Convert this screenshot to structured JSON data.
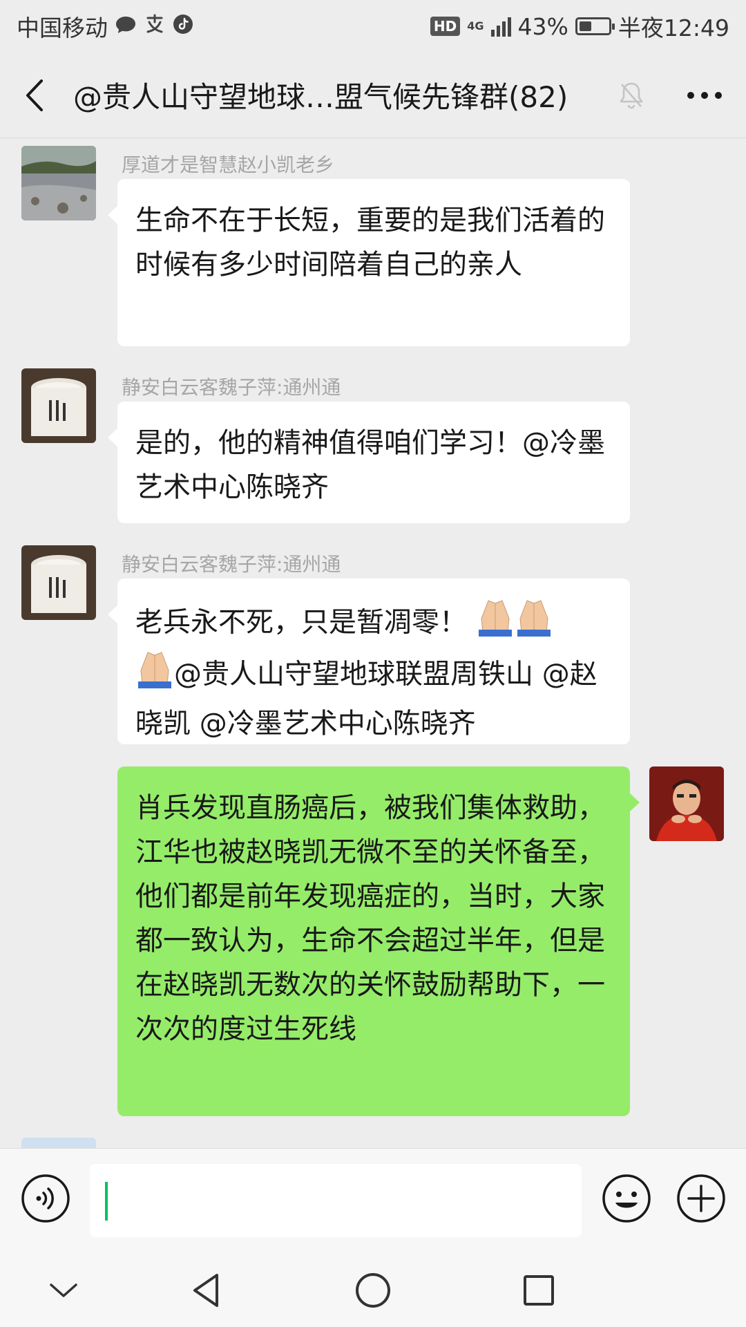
{
  "status_bar": {
    "carrier": "中国移动",
    "network": "4G",
    "battery": "43%",
    "battery_level": 0.43,
    "time": "半夜12:49"
  },
  "header": {
    "title": "@贵人山守望地球…盟气候先锋群(82)"
  },
  "messages": [
    {
      "sender": "厚道才是智慧赵小凯老乡",
      "text": "生命不在于长短，重要的是我们活着的时候有多少时间陪着自己的亲人",
      "direction": "incoming",
      "avatar": "river-landscape"
    },
    {
      "sender": "静安白云客魏子萍:通州通",
      "text": "是的，他的精神值得咱们学习！@冷墨艺术中心陈晓齐",
      "direction": "incoming",
      "avatar": "enamel-mug"
    },
    {
      "sender": "静安白云客魏子萍:通州通",
      "text_before": "老兵永不死，只是暂凋零！",
      "text_after": "@贵人山守望地球联盟周铁山 @赵晓凯  @冷墨艺术中心陈晓齐",
      "emoji_count": 3,
      "emoji": "folded-hands",
      "direction": "incoming",
      "avatar": "enamel-mug"
    },
    {
      "text": "肖兵发现直肠癌后，被我们集体救助，江华也被赵晓凯无微不至的关怀备至，他们都是前年发现癌症的，当时，大家都一致认为，生命不会超过半年，但是在赵晓凯无数次的关怀鼓励帮助下，一次次的度过生死线",
      "direction": "outgoing",
      "avatar": "man-in-red"
    }
  ],
  "input": {
    "value": "",
    "placeholder": ""
  },
  "icons": {
    "back": "back-arrow-icon",
    "mute": "bell-muted-icon",
    "more": "more-dots-icon",
    "voice": "voice-icon",
    "emoji": "emoji-smile-icon",
    "plus": "plus-icon",
    "nav_down": "chevron-down-icon",
    "nav_back": "triangle-back-icon",
    "nav_home": "circle-home-icon",
    "nav_recent": "square-recent-icon"
  },
  "colors": {
    "background": "#ededed",
    "incoming_bubble": "#ffffff",
    "outgoing_bubble": "#95ec69",
    "sender_name": "#a6a6a6",
    "cursor": "#07c160"
  }
}
